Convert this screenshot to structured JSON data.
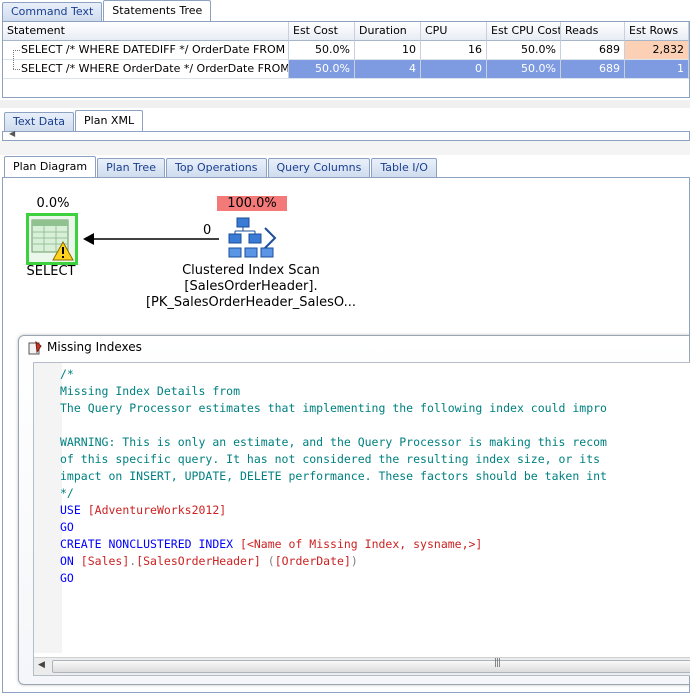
{
  "top_tabs": [
    "Command Text",
    "Statements Tree"
  ],
  "grid": {
    "headers": [
      "Statement",
      "Est Cost",
      "Duration",
      "CPU",
      "Est CPU Cost",
      "Reads",
      "Est Rows"
    ],
    "rows": [
      {
        "statement": "SELECT /* WHERE DATEDIFF */ OrderDate FROM ...",
        "est_cost": "50.0%",
        "duration": "10",
        "cpu": "16",
        "est_cpu_cost": "50.0%",
        "reads": "689",
        "est_rows": "2,832"
      },
      {
        "statement": "SELECT /* WHERE OrderDate */ OrderDate FROM ...",
        "est_cost": "50.0%",
        "duration": "4",
        "cpu": "0",
        "est_cpu_cost": "50.0%",
        "reads": "689",
        "est_rows": "1"
      }
    ]
  },
  "mid_tabs": [
    "Text Data",
    "Plan XML"
  ],
  "plan_tabs": [
    "Plan Diagram",
    "Plan Tree",
    "Top Operations",
    "Query Columns",
    "Table I/O"
  ],
  "plan": {
    "select_pct": "0.0%",
    "select_label": "SELECT",
    "arrow_rows": "0",
    "scan_pct": "100.0%",
    "scan_line1": "Clustered Index Scan",
    "scan_line2": "[SalesOrderHeader].",
    "scan_line3": "[PK_SalesOrderHeader_SalesO..."
  },
  "missing_indexes": {
    "title": "Missing Indexes",
    "code": {
      "c1": "/*",
      "c2": "Missing Index Details from",
      "c3": "The Query Processor estimates that implementing the following index could impro",
      "c4": "WARNING: This is only an estimate, and the Query Processor is making this recom",
      "c5": "of this specific query. It has not considered the resulting index size, or its",
      "c6": "impact on INSERT, UPDATE, DELETE performance. These factors should be taken int",
      "c7": "*/",
      "use_kw": "USE",
      "use_db": "[AdventureWorks2012]",
      "go1": "GO",
      "create_kw": "CREATE NONCLUSTERED INDEX",
      "create_name": "[<Name of Missing Index, sysname,>]",
      "on_kw": "ON",
      "on_schema": "[Sales]",
      "on_dot": ".",
      "on_table": "[SalesOrderHeader]",
      "on_paren_open": "(",
      "on_col": "[OrderDate]",
      "on_paren_close": ")",
      "go2": "GO"
    }
  },
  "colors": {
    "selected_row": "#7e9ae0",
    "highlight_cell": "#fbd0b5",
    "scan_pct_bg": "#f47a7a",
    "select_border": "#3dd13d",
    "comment": "#008080",
    "keyword": "#0000ff",
    "bracket": "#cc2222"
  }
}
